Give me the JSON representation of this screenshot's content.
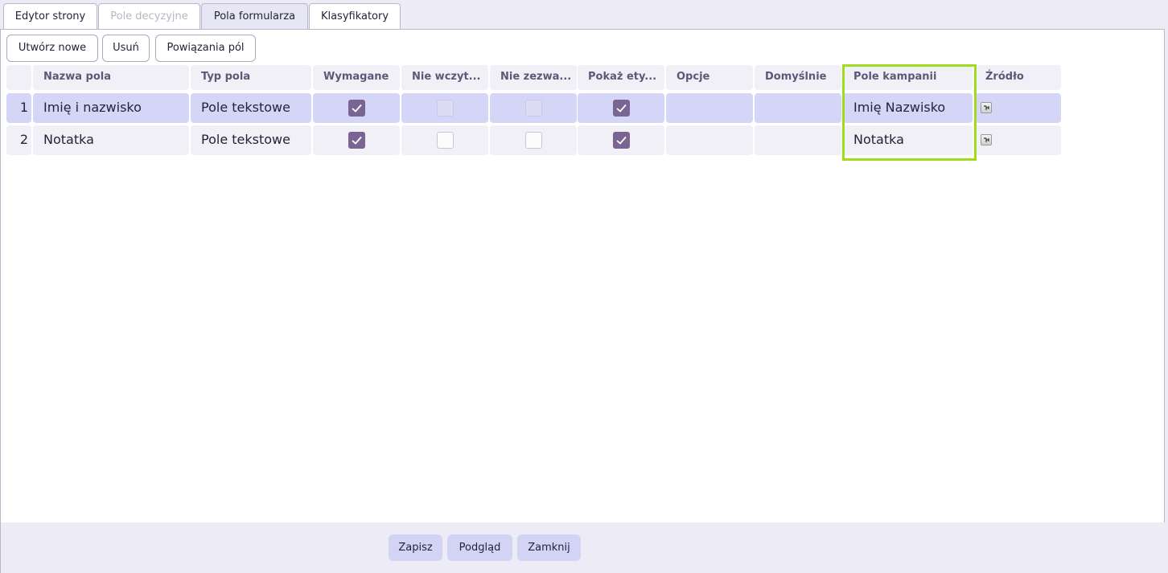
{
  "tabs": [
    {
      "label": "Edytor strony",
      "state": "normal"
    },
    {
      "label": "Pole decyzyjne",
      "state": "disabled"
    },
    {
      "label": "Pola formularza",
      "state": "active"
    },
    {
      "label": "Klasyfikatory",
      "state": "normal"
    }
  ],
  "toolbar": {
    "create_label": "Utwórz nowe",
    "delete_label": "Usuń",
    "bindings_label": "Powiązania pól"
  },
  "table": {
    "headers": [
      "Nazwa pola",
      "Typ pola",
      "Wymagane",
      "Nie wczyt...",
      "Nie zezwa...",
      "Pokaż ety...",
      "Opcje",
      "Domyślnie",
      "Pole kampanii",
      "Źródło"
    ],
    "rows": [
      {
        "num": "1",
        "name": "Imię i nazwisko",
        "type": "Pole tekstowe",
        "required": true,
        "no_load": false,
        "no_allow": false,
        "show_label": true,
        "options": "",
        "default": "",
        "campaign_field": "Imię Nazwisko",
        "selected": true
      },
      {
        "num": "2",
        "name": "Notatka",
        "type": "Pole tekstowe",
        "required": true,
        "no_load": false,
        "no_allow": false,
        "show_label": true,
        "options": "",
        "default": "",
        "campaign_field": "Notatka",
        "selected": false
      }
    ]
  },
  "highlight_color": "#9fdc1f",
  "accent_checkbox_color": "#7a6592",
  "footer": {
    "save_label": "Zapisz",
    "preview_label": "Podgląd",
    "close_label": "Zamknij"
  }
}
